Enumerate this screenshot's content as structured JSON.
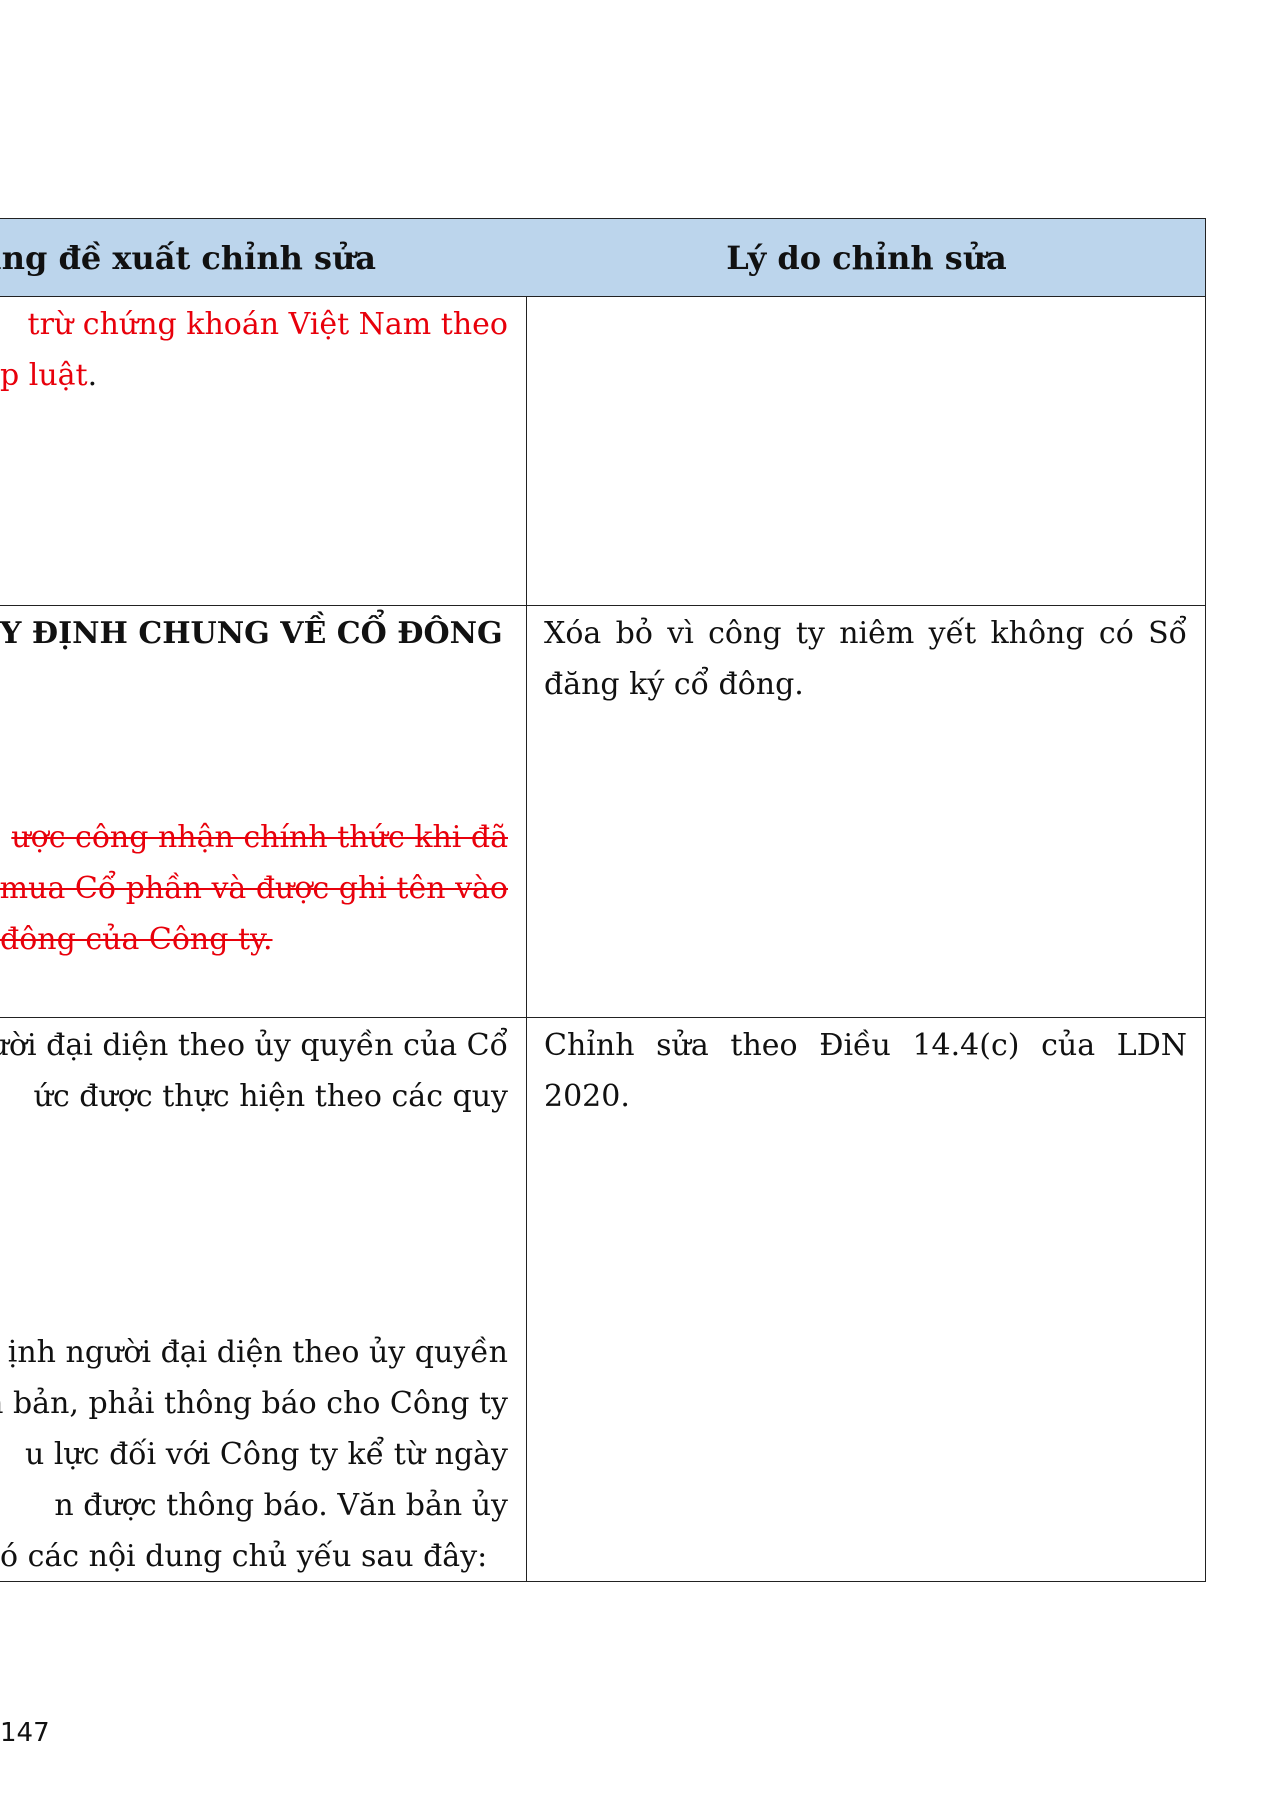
{
  "table": {
    "header": {
      "left": "dung đề xuất chỉnh sửa",
      "right": "Lý do chỉnh sửa"
    },
    "rows": [
      {
        "left_lines": [
          {
            "text": "trừ chứng khoán Việt Nam theo",
            "style": "red"
          },
          {
            "text": "p luật",
            "style": "red",
            "suffix": "."
          }
        ],
        "right_lines": []
      },
      {
        "left_lines": [
          {
            "text": "Y ĐỊNH CHUNG VỀ CỔ ĐÔNG",
            "style": "bold"
          },
          {
            "text": "ược công nhận chính thức khi đã",
            "style": "red-strike"
          },
          {
            "text": "mua Cổ phần và được ghi tên vào",
            "style": "red-strike"
          },
          {
            "text": " đông của Công ty.",
            "style": "red-strike"
          }
        ],
        "right_lines": [
          "Xóa bỏ vì công ty niêm yết không có Sổ",
          "đăng ký cổ đông."
        ]
      },
      {
        "left_lines": [
          {
            "text": "ười đại diện theo ủy quyền của Cổ",
            "style": "normal"
          },
          {
            "text": "ức được thực hiện theo các quy",
            "style": "normal"
          },
          {
            "text": "ịnh người đại diện theo ủy quyền",
            "style": "normal"
          },
          {
            "text": "n bản, phải thông báo cho Công ty",
            "style": "normal"
          },
          {
            "text": "u lực đối với Công ty kể từ ngày",
            "style": "normal"
          },
          {
            "text": "n được thông báo. Văn bản ủy",
            "style": "normal"
          },
          {
            "text": "ó các nội dung chủ yếu sau đây:",
            "style": "normal"
          }
        ],
        "right_lines": [
          "Chỉnh sửa theo Điều 14.4(c) của LDN",
          "2020."
        ]
      }
    ]
  },
  "page_number": "147",
  "colors": {
    "header_bg": "#bcd5ec",
    "accent_red": "#e8000b",
    "border": "#222222"
  }
}
